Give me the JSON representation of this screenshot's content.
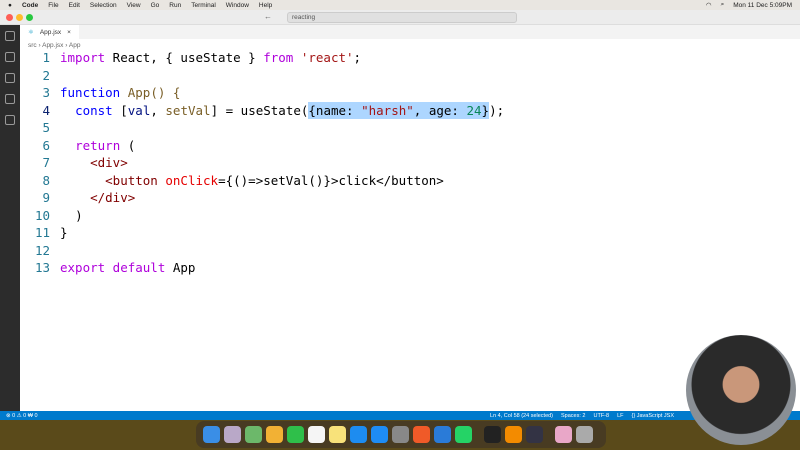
{
  "menubar": {
    "app": "Code",
    "items": [
      "File",
      "Edit",
      "Selection",
      "View",
      "Go",
      "Run",
      "Terminal",
      "Window",
      "Help"
    ],
    "clock": "Mon 11 Dec  5:09PM"
  },
  "search": "reacting",
  "tab": {
    "label": "App.jsx",
    "close": "×"
  },
  "breadcrumb": [
    "src",
    "›",
    "App.jsx",
    "›",
    "App"
  ],
  "code": {
    "lines": [
      "1",
      "2",
      "3",
      "4",
      "5",
      "6",
      "7",
      "8",
      "9",
      "10",
      "11",
      "12",
      "13"
    ],
    "t": {
      "import": "import",
      "react1": " React, { useState } ",
      "from": "from",
      "mod": " 'react'",
      "function": "function",
      "app": " App() {",
      "const": "const",
      "v1": " [",
      "val": "val",
      ", ": ", ",
      "setVal": "setVal",
      "eq": "] = useState(",
      "sel1": "{name: ",
      "harsh": "\"harsh\"",
      "sel2": ", age: ",
      "n24": "24",
      "sel3": "}",
      "end": ");",
      "ret": "return",
      "paren": " (",
      "div": "<div>",
      "btn": "<button ",
      "onclick": "onClick",
      "expr": "={()=>setVal()}>click</button>",
      "cdiv": "</div>",
      "cp": ")",
      "cb": "}",
      "export": "export default",
      "appx": " App"
    }
  },
  "status": {
    "left": "⊗ 0 ⚠ 0   ₩ 0",
    "pos": "Ln 4, Col 58 (24 selected)",
    "spaces": "Spaces: 2",
    "enc": "UTF-8",
    "eol": "LF",
    "lang": "{} JavaScript JSX"
  }
}
